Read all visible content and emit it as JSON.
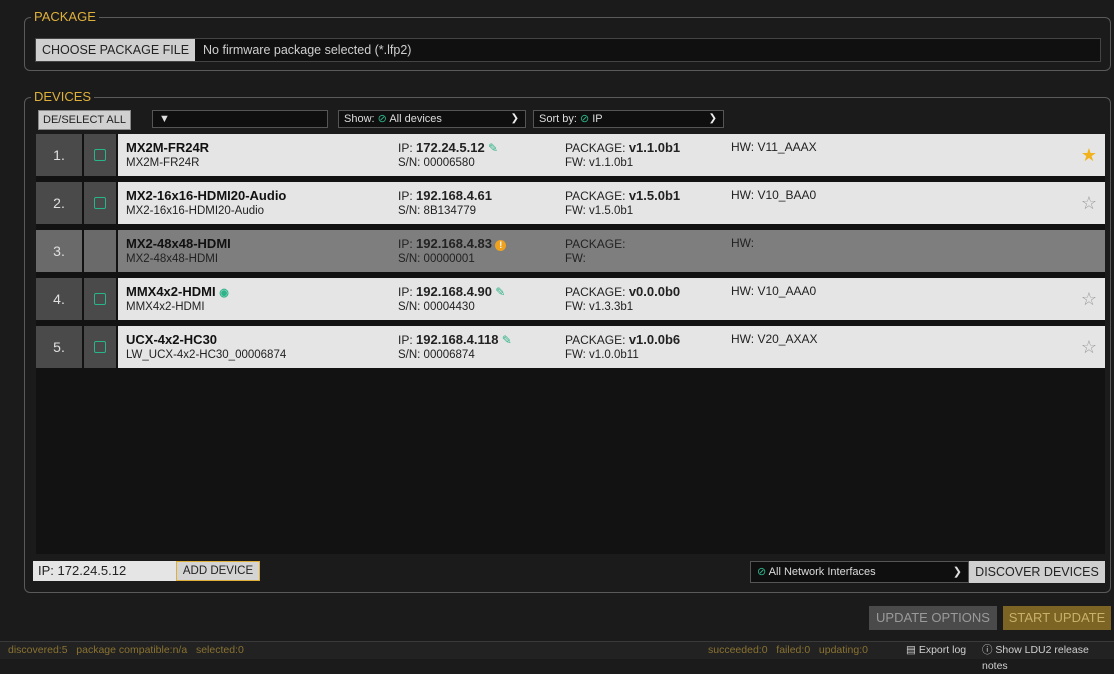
{
  "package": {
    "legend": "PACKAGE",
    "choose_button": "CHOOSE PACKAGE FILE",
    "selected_text": "No firmware package selected (*.lfp2)"
  },
  "devices": {
    "legend": "DEVICES",
    "select_all": "DE/SELECT ALL",
    "filter_icon": "filter-icon",
    "show_label": "Show:",
    "show_value": "All devices",
    "sort_label": "Sort by:",
    "sort_value": "IP",
    "rows": [
      {
        "num": "1.",
        "name": "MX2M-FR24R",
        "sub": "MX2M-FR24R",
        "ip_label": "IP:",
        "ip": "172.24.5.12",
        "sn": "S/N: 00006580",
        "pkg_label": "PACKAGE:",
        "pkg": "v1.1.0b1",
        "fw": "FW: v1.1.0b1",
        "hw": "HW: V11_AAAX",
        "favorite": true
      },
      {
        "num": "2.",
        "name": "MX2-16x16-HDMI20-Audio",
        "sub": "MX2-16x16-HDMI20-Audio",
        "ip_label": "IP:",
        "ip": "192.168.4.61",
        "sn": "S/N: 8B134779",
        "pkg_label": "PACKAGE:",
        "pkg": "v1.5.0b1",
        "fw": "FW: v1.5.0b1",
        "hw": "HW: V10_BAA0",
        "favorite": false
      },
      {
        "num": "3.",
        "name": "MX2-48x48-HDMI",
        "sub": "MX2-48x48-HDMI",
        "ip_label": "IP:",
        "ip": "192.168.4.83",
        "sn": "S/N: 00000001",
        "pkg_label": "PACKAGE:",
        "pkg": "",
        "fw": "FW:",
        "hw": "HW:",
        "favorite": false
      },
      {
        "num": "4.",
        "name": "MMX4x2-HDMI",
        "sub": "MMX4x2-HDMI",
        "ip_label": "IP:",
        "ip": "192.168.4.90",
        "sn": "S/N: 00004430",
        "pkg_label": "PACKAGE:",
        "pkg": "v0.0.0b0",
        "fw": "FW: v1.3.3b1",
        "hw": "HW: V10_AAA0",
        "favorite": false
      },
      {
        "num": "5.",
        "name": "UCX-4x2-HC30",
        "sub": "LW_UCX-4x2-HC30_00006874",
        "ip_label": "IP:",
        "ip": "192.168.4.118",
        "sn": "S/N: 00006874",
        "pkg_label": "PACKAGE:",
        "pkg": "v1.0.0b6",
        "fw": "FW: v1.0.0b11",
        "hw": "HW: V20_AXAX",
        "favorite": false
      }
    ],
    "ip_input_label": "IP:",
    "ip_input_value": "172.24.5.12",
    "add_device": "ADD DEVICE",
    "network_interfaces": "All Network Interfaces",
    "discover": "DISCOVER DEVICES"
  },
  "actions": {
    "update_options": "UPDATE OPTIONS",
    "start_update": "START UPDATE"
  },
  "status": {
    "left": "discovered:5   package compatible:n/a   selected:0",
    "right": "succeeded:0   failed:0   updating:0",
    "export_log": "Export log",
    "release_notes": "Show LDU2 release notes"
  },
  "colors": {
    "accent": "#e0b13a",
    "green": "#2fb489",
    "star": "#f2b21e"
  }
}
